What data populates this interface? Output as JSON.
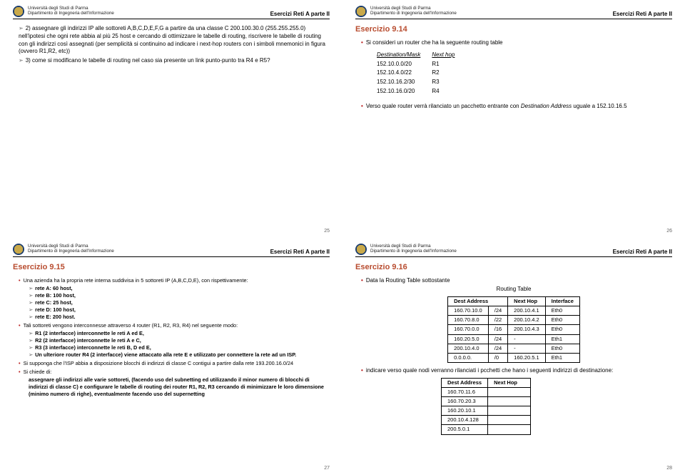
{
  "header": {
    "uni": "Università degli Studi di Parma",
    "dept": "Dipartimento di Ingegneria dell'Informazione",
    "course": "Esercizi Reti A parte II"
  },
  "slide25": {
    "p1": "2) assegnare gli indirizzi IP alle sottoreti A,B,C,D,E,F,G a partire da una classe C 200.100.30.0 (255.255.255.0) nell'ipotesi che ogni rete abbia al più 25 host e cercando di ottimizzare le tabelle di routing, riscrivere le tabelle di routing con gli indirizzi così assegnati (per semplicità si continuino ad indicare i next-hop routers con i simboli mnemonici in figura (ovvero R1,R2, etc))",
    "p2": "3) come si modificano le tabelle di routing nel caso sia presente un link punto-punto tra R4 e R5?",
    "page": "25"
  },
  "slide26": {
    "title": "Esercizio 9.14",
    "intro": "Si consideri un router che ha la seguente routing table",
    "cols": {
      "c1": "Destination/Mask",
      "c2": "Next hop"
    },
    "rows": [
      {
        "d": "152.10.0.0/20",
        "n": "R1"
      },
      {
        "d": "152.10.4.0/22",
        "n": "R2"
      },
      {
        "d": "152.10.16.2/30",
        "n": "R3"
      },
      {
        "d": "152.10.16.0/20",
        "n": "R4"
      }
    ],
    "q": "Verso quale router verrà rilanciato un pacchetto entrante con",
    "q2a": "Destination Address",
    "q2b": " uguale a 152.10.16.5",
    "page": "26"
  },
  "slide27": {
    "title": "Esercizio 9.15",
    "intro": "Una azienda ha la propria rete interna suddivisa in 5 sottoreti IP (A,B,C,D,E), con rispettivamente:",
    "nets": [
      "rete A: 60 host,",
      "rete B: 100 host,",
      "rete C: 25 host,",
      "rete D: 100 host,",
      "rete E: 200 host."
    ],
    "p2": "Tali sottoreti vengono interconnesse attraverso 4 router (R1, R2, R3, R4) nel seguente modo:",
    "modes": [
      "R1 (2 interfacce) interconnette le reti A ed E,",
      "R2 (2 interfacce) interconnette le reti A e C,",
      "R3 (3 interfacce) interconnette le reti B, D ed E,",
      "Un ulteriore router R4 (2 interfacce) viene attaccato alla rete E e utilizzato per connettere la rete ad un ISP."
    ],
    "p3": "Si supponga che l'ISP abbia a disposizione blocchi di indirizzi di classe C contigui a partire dalla rete 193.200.16.0/24",
    "p4": "Si chiede di:",
    "req": "assegnare gli indirizzi alle varie sottoreti, (facendo uso del subnetting ed utilizzando il minor numero di blocchi di indirizzi di classe C) e configurare le tabelle di routing dei router R1, R2, R3 cercando di minimizzare le loro dimensione (minimo numero di righe), eventualmente facendo uso del supernetting",
    "page": "27"
  },
  "slide28": {
    "title": "Esercizio 9.16",
    "intro": "Data la Routing Table sottostante",
    "tblTitle": "Routing Table",
    "cols": {
      "c1": "Dest Address",
      "c2": "Next Hop",
      "c3": "Interface"
    },
    "rows": [
      {
        "a": "160.70.10.0",
        "m": "/24",
        "n": "200.10.4.1",
        "i": "Eth0"
      },
      {
        "a": "160.70.8.0",
        "m": "/22",
        "n": "200.10.4.2",
        "i": "Eth0"
      },
      {
        "a": "160.70.0.0",
        "m": "/16",
        "n": "200.10.4.3",
        "i": "Eth0"
      },
      {
        "a": "160.20.5.0",
        "m": "/24",
        "n": "-",
        "i": "Eth1"
      },
      {
        "a": "200.10.4.0",
        "m": "/24",
        "n": "-",
        "i": "Eth0"
      },
      {
        "a": "0.0.0.0.",
        "m": "/0",
        "n": "160.20.5.1",
        "i": "Eth1"
      }
    ],
    "q": "indicare verso quale nodi verranno rilanciati i pcchetti che hano i seguenti indirizzi di destinazione:",
    "cols2": {
      "c1": "Dest Address",
      "c2": "Next Hop"
    },
    "addrs": [
      "160.70.11.6",
      "160.70.20.3",
      "160.20.10.1",
      "200.10.4.128",
      "200.5.0.1"
    ],
    "page": "28"
  }
}
